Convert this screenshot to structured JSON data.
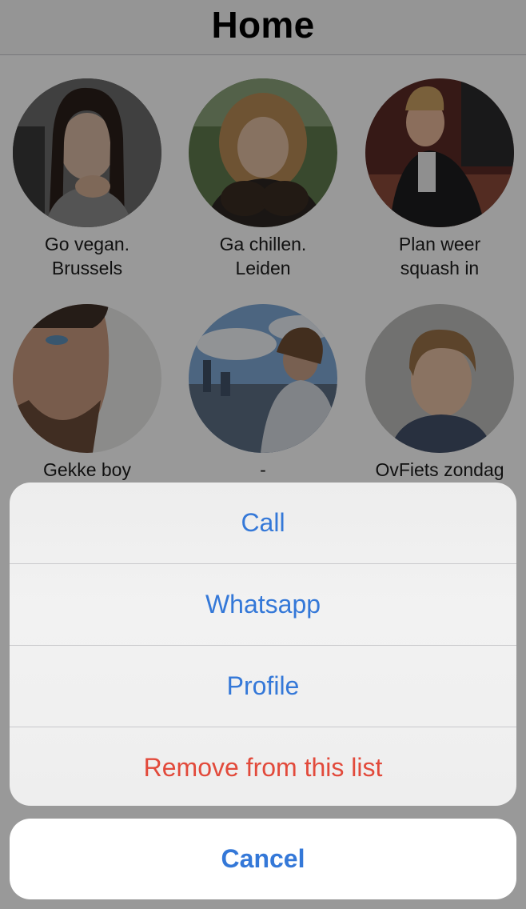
{
  "nav": {
    "title": "Home"
  },
  "contacts": [
    {
      "label": "Go vegan.\nBrussels"
    },
    {
      "label": "Ga chillen.\nLeiden"
    },
    {
      "label": "Plan weer\nsquash in"
    },
    {
      "label": "Gekke boy"
    },
    {
      "label": "-"
    },
    {
      "label": "OvFiets zondag"
    }
  ],
  "action_sheet": {
    "actions": [
      {
        "label": "Call",
        "style": "default"
      },
      {
        "label": "Whatsapp",
        "style": "default"
      },
      {
        "label": "Profile",
        "style": "default"
      },
      {
        "label": "Remove from this list",
        "style": "destructive"
      }
    ],
    "cancel_label": "Cancel"
  },
  "colors": {
    "tint": "#3478d8",
    "destructive": "#e24a3b"
  }
}
